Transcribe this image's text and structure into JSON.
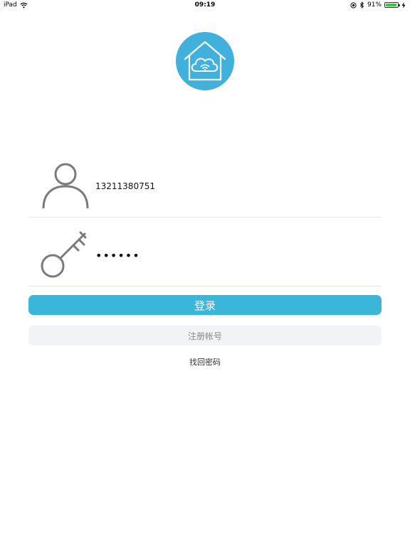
{
  "status_bar": {
    "device": "iPad",
    "time": "09:19",
    "battery_percent": "91%",
    "battery_level": 0.91,
    "icons": [
      "wifi-icon",
      "location-icon",
      "bluetooth-icon",
      "battery-icon",
      "charging-icon"
    ]
  },
  "brand": {
    "logo_icon": "cloud-home-wifi-icon",
    "accent_color": "#41b0db"
  },
  "login": {
    "username_icon": "user-icon",
    "username_value": "13211380751",
    "password_icon": "key-icon",
    "password_value": "••••••",
    "login_label": "登录",
    "register_label": "注册帐号",
    "forgot_label": "找回密码"
  },
  "colors": {
    "primary_button": "#3ab6db",
    "secondary_button": "#f2f3f4",
    "divider": "#e4e4e4"
  }
}
